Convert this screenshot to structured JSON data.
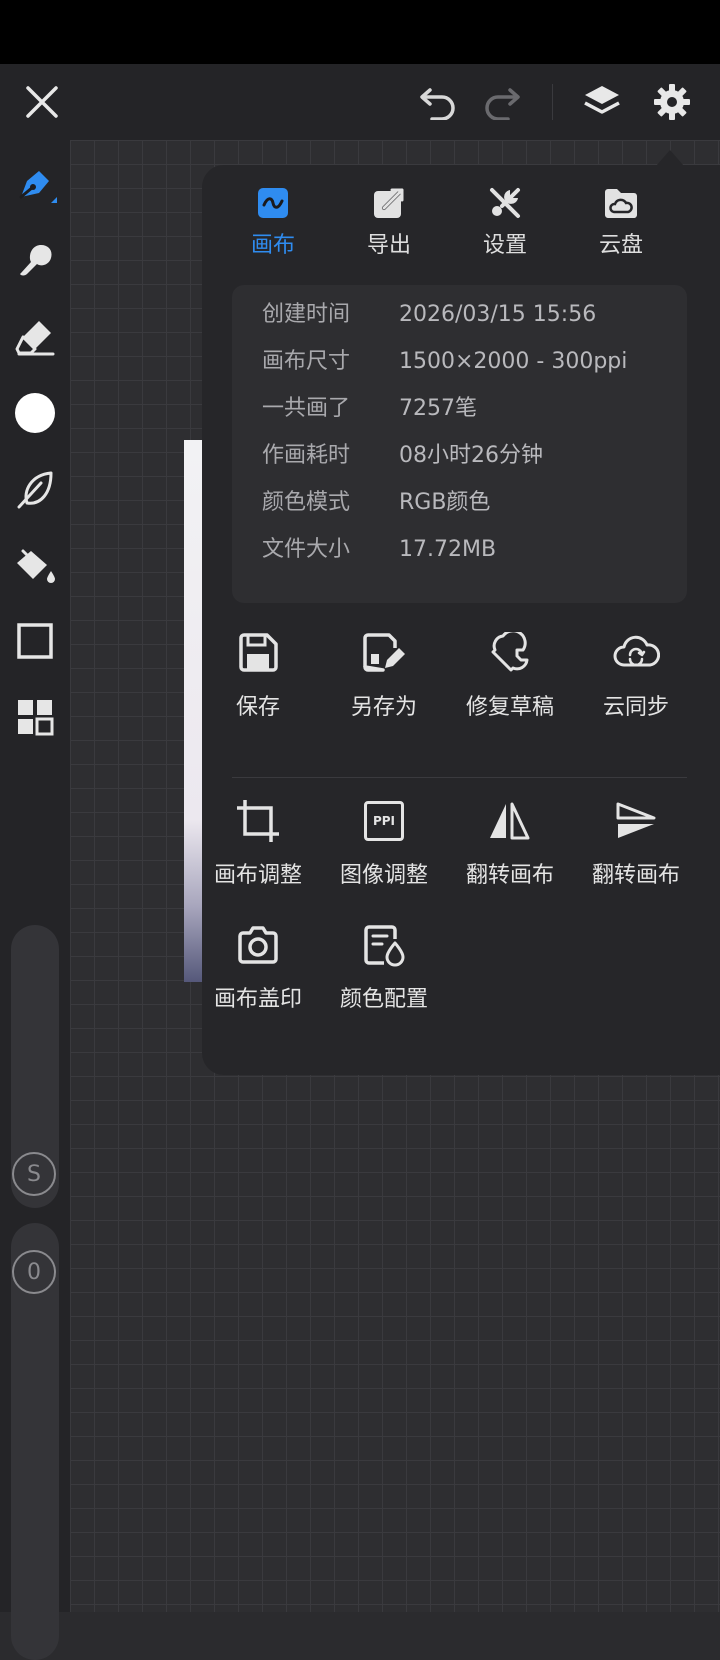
{
  "topbar": {
    "close_icon": "close-icon",
    "undo_icon": "undo-icon",
    "redo_icon": "redo-icon",
    "layers_icon": "layers-icon",
    "settings_icon": "gear-icon"
  },
  "toolbar": {
    "tools": [
      "pen-icon",
      "smudge-icon",
      "eraser-icon",
      "color-swatch",
      "leaf-brush-icon",
      "bucket-icon",
      "rectangle-select-icon",
      "grid-icon"
    ],
    "accent_color": "#2f8cf0",
    "size_label": "S",
    "opacity_label": "0"
  },
  "panel": {
    "tabs": [
      {
        "label": "画布",
        "icon": "canvas-icon",
        "active": true
      },
      {
        "label": "导出",
        "icon": "export-icon",
        "active": false
      },
      {
        "label": "设置",
        "icon": "tools-icon",
        "active": false
      },
      {
        "label": "云盘",
        "icon": "cloud-folder-icon",
        "active": false
      }
    ],
    "info": [
      {
        "key": "创建时间",
        "value": "2026/03/15 15:56"
      },
      {
        "key": "画布尺寸",
        "value": "1500×2000 - 300ppi"
      },
      {
        "key": "一共画了",
        "value": "7257笔"
      },
      {
        "key": "作画耗时",
        "value": "08小时26分钟"
      },
      {
        "key": "颜色模式",
        "value": "RGB颜色"
      },
      {
        "key": "文件大小",
        "value": "17.72MB"
      }
    ],
    "file_actions": [
      {
        "label": "保存",
        "icon": "save-icon"
      },
      {
        "label": "另存为",
        "icon": "save-as-icon"
      },
      {
        "label": "修复草稿",
        "icon": "wrench-icon"
      },
      {
        "label": "云同步",
        "icon": "cloud-sync-icon"
      }
    ],
    "canvas_actions": [
      {
        "label": "画布调整",
        "icon": "crop-icon"
      },
      {
        "label": "图像调整",
        "icon": "ppi-icon",
        "icon_text": "PPI"
      },
      {
        "label": "翻转画布",
        "icon": "flip-horizontal-icon"
      },
      {
        "label": "翻转画布",
        "icon": "flip-vertical-icon"
      },
      {
        "label": "画布盖印",
        "icon": "camera-icon"
      },
      {
        "label": "颜色配置",
        "icon": "color-profile-icon"
      }
    ]
  }
}
